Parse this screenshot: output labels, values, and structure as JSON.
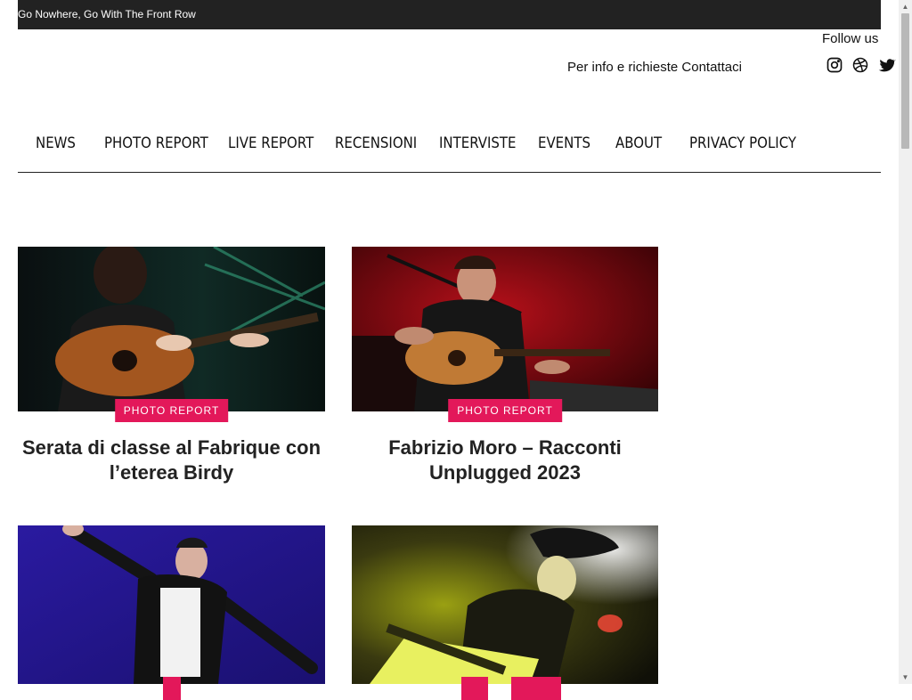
{
  "topbar": {
    "tagline": "Go Nowhere, Go With The Front Row"
  },
  "header": {
    "follow_label": "Follow us",
    "contact_prefix": "Per info e richieste ",
    "contact_link": "Contattaci",
    "social": [
      {
        "icon": "instagram-icon"
      },
      {
        "icon": "dribbble-icon"
      },
      {
        "icon": "twitter-icon"
      }
    ]
  },
  "nav": {
    "items": [
      "NEWS",
      "PHOTO REPORT",
      "LIVE REPORT",
      "RECENSIONI",
      "INTERVISTE",
      "EVENTS",
      "ABOUT",
      "PRIVACY POLICY"
    ]
  },
  "posts": [
    {
      "category": "PHOTO REPORT",
      "title": "Serata di classe al Fabrique con l’eterea Birdy"
    },
    {
      "category": "PHOTO REPORT",
      "title": "Fabrizio Moro – Racconti Unplugged 2023"
    }
  ],
  "colors": {
    "accent": "#e3185a",
    "topbar": "#222222"
  }
}
